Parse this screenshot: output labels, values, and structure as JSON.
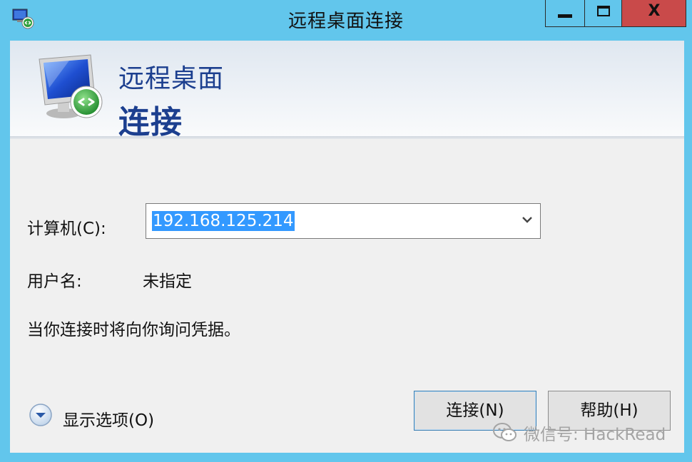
{
  "window": {
    "title": "远程桌面连接"
  },
  "titlebar": {
    "minimize_icon": "minimize-icon",
    "maximize_icon": "maximize-icon",
    "close_glyph": "X"
  },
  "banner": {
    "line1": "远程桌面",
    "line2": "连接",
    "icon": "remote-desktop-monitor-icon"
  },
  "form": {
    "computer_label": "计算机(C):",
    "computer_value": "192.168.125.214",
    "user_label": "用户名:",
    "user_value": "未指定",
    "hint": "当你连接时将向你询问凭据。"
  },
  "footer": {
    "options_label": "显示选项(O)",
    "connect_label": "连接(N)",
    "help_label": "帮助(H)"
  },
  "watermark": {
    "text": "微信号: HackRead"
  },
  "colors": {
    "frame": "#62c6ec",
    "close_button": "#c94a4a",
    "banner_text": "#1c3f8f",
    "selection": "#3399ff"
  }
}
